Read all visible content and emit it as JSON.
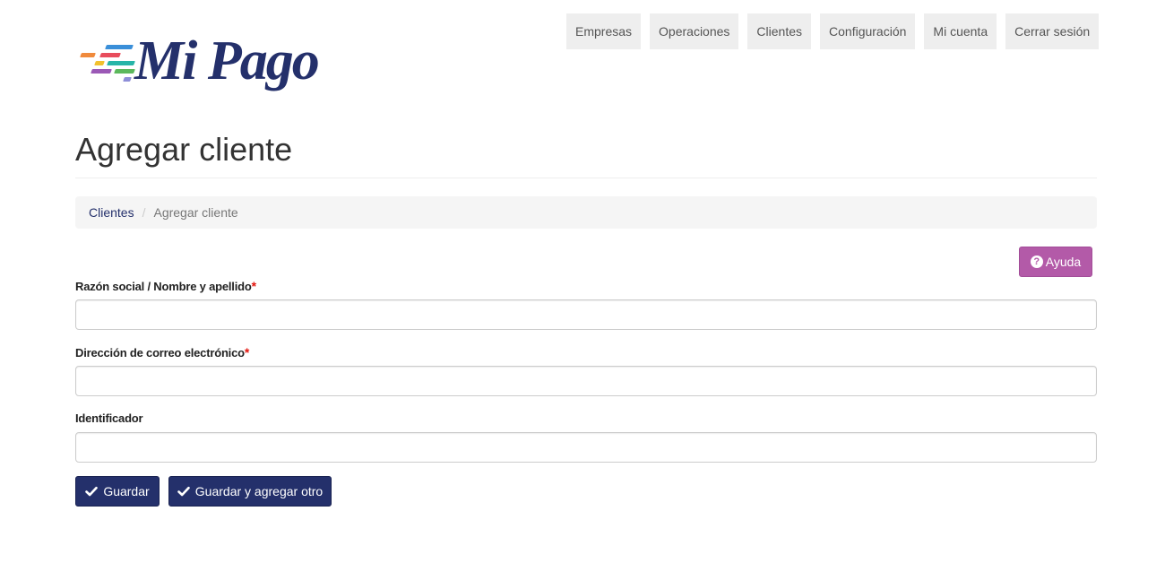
{
  "logo": {
    "text": "Mi Pago",
    "bar_colors": [
      "#f08a3c",
      "#3a8fd9",
      "#e84c5c",
      "#27b5a8",
      "#f2c12e",
      "#5cb85c",
      "#9b59b6",
      "#8e8ed8"
    ]
  },
  "nav": {
    "items": [
      "Empresas",
      "Operaciones",
      "Clientes",
      "Configuración",
      "Mi cuenta",
      "Cerrar sesión"
    ]
  },
  "page": {
    "title": "Agregar cliente"
  },
  "breadcrumb": {
    "parent": "Clientes",
    "separator": "/",
    "current": "Agregar cliente"
  },
  "help_button": {
    "label": "Ayuda",
    "icon": "question-circle-icon"
  },
  "form": {
    "name_label": "Razón social / Nombre y apellido",
    "name_value": "",
    "email_label": "Dirección de correo electrónico",
    "email_value": "",
    "id_label": "Identificador",
    "id_value": "",
    "required_mark": "*"
  },
  "actions": {
    "save_label": "Guardar",
    "save_add_label": "Guardar y agregar otro",
    "icon": "check-icon"
  },
  "colors": {
    "brand": "#24306b",
    "help": "#b35aa8",
    "required": "#e3140c"
  }
}
